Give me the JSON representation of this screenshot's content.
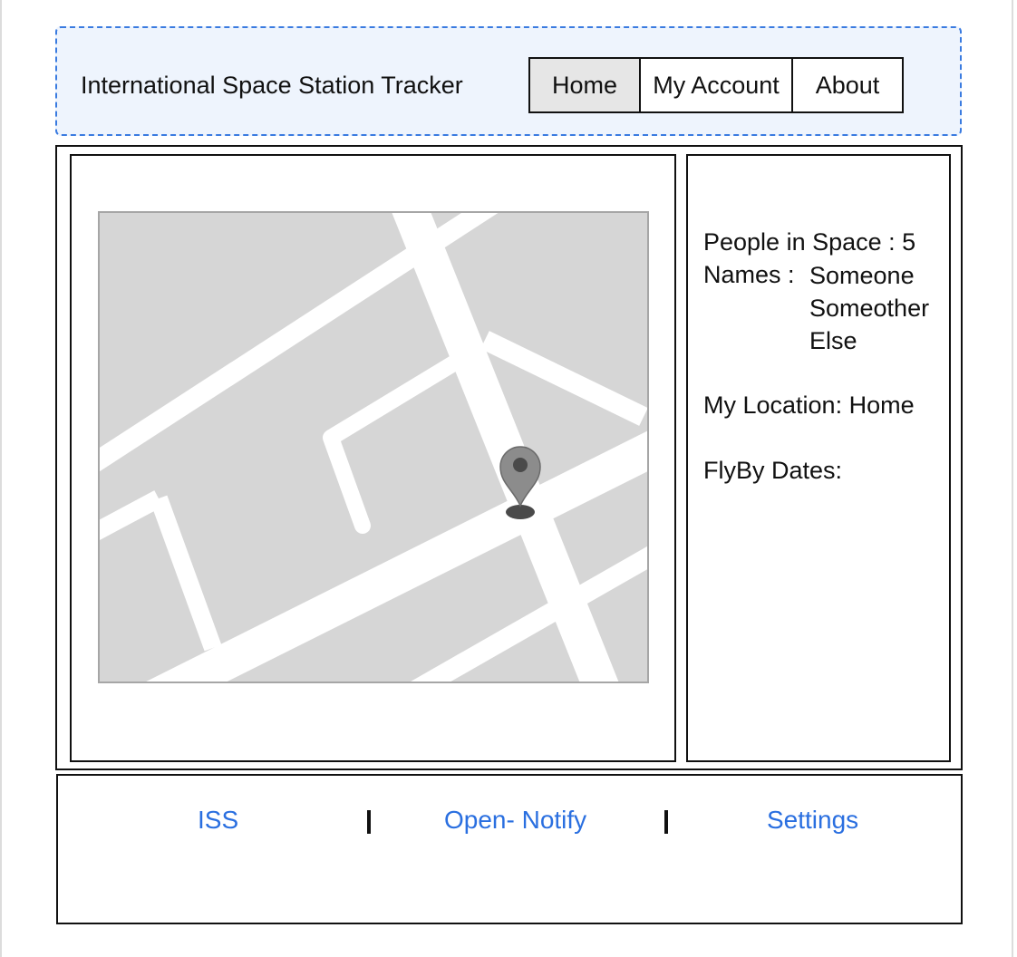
{
  "header": {
    "title": "International Space Station Tracker",
    "nav": [
      {
        "label": "Home",
        "active": true
      },
      {
        "label": "My Account",
        "active": false
      },
      {
        "label": "About",
        "active": false
      }
    ]
  },
  "info": {
    "people_in_space": "People in Space : 5",
    "names_label": "Names :",
    "names": [
      "Someone",
      "Someother",
      "Else"
    ],
    "my_location": "My Location: Home",
    "flyby_dates": "FlyBy Dates:"
  },
  "map": {
    "marker_icon": "map-pin-icon",
    "colors": {
      "background": "#d6d6d6",
      "roads": "#ffffff",
      "pin": "#8c8c8c"
    }
  },
  "footer": {
    "links": [
      "ISS",
      "Open- Notify",
      "Settings"
    ],
    "link_color": "#2a6fe0"
  }
}
